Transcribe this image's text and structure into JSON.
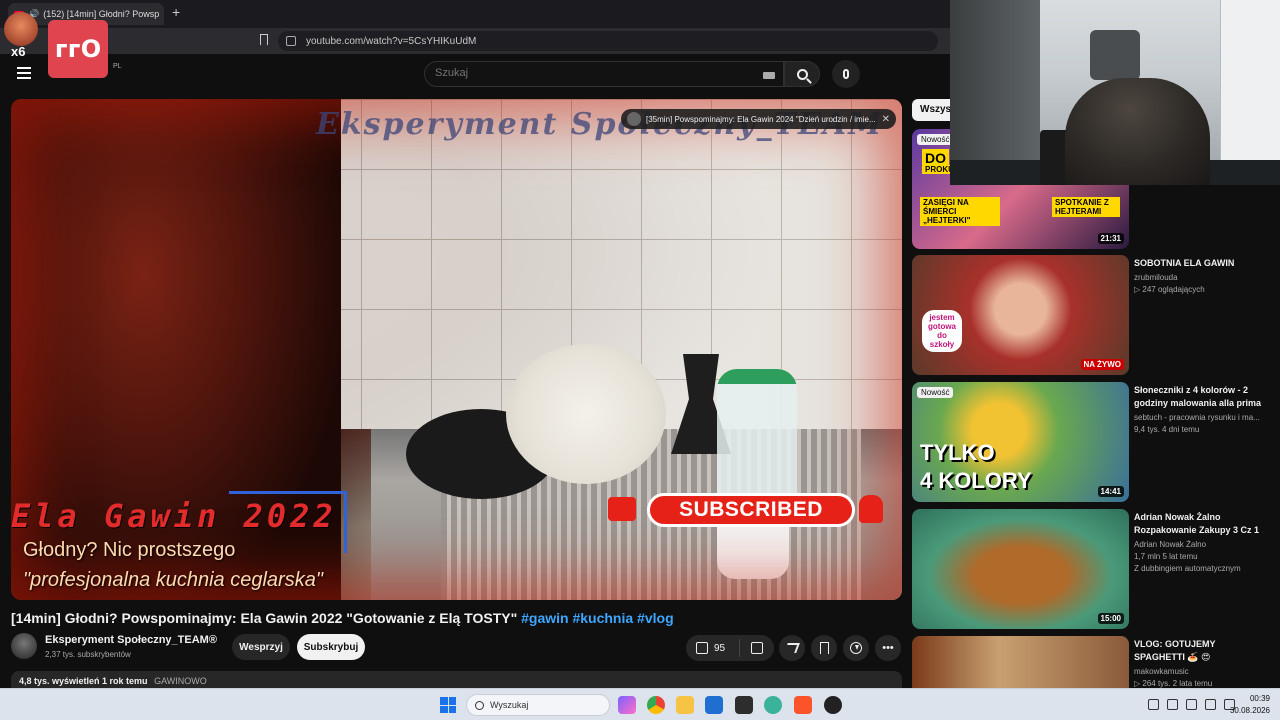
{
  "browser": {
    "tab_title": "(152) [14min] Głodni? Powsp",
    "url": "youtube.com/watch?v=5CsYHIKuUdM"
  },
  "masthead": {
    "logo": "e",
    "region": "PL",
    "search_placeholder": "Szukaj"
  },
  "overlay_badge": {
    "multiplier": "x6",
    "badge_text": "ᴦᴦO"
  },
  "player": {
    "watermark": "Eksperyment Społeczny_TEAM",
    "overlay_title": "Ela Gawin 2022",
    "overlay_sub1": "Głodny? Nic prostszego",
    "overlay_sub2": "\"profesjonalna kuchnia ceglarska\"",
    "subscribed_banner": "SUBSCRIBED",
    "card_text": "[35min] Powspominajmy: Ela Gawin 2024 \"Dzień urodzin / imie...",
    "card_close": "✕"
  },
  "video": {
    "title": "[14min] Głodni? Powspominajmy: Ela Gawin 2022 \"Gotowanie z Elą TOSTY\"",
    "tags": "#gawin #kuchnia #vlog",
    "channel_name": "Eksperyment Społeczny_TEAM®",
    "subscribers": "2,37 tys. subskrybentów",
    "support_label": "Wesprzyj",
    "subscribe_label": "Subskrybuj",
    "likes": "95",
    "more": "•••",
    "views": "4,8 tys. wyświetleń  1 rok temu",
    "hashtag_line": "GAWINOWO"
  },
  "sidebar": {
    "chip_label": "Wszyst",
    "items": [
      {
        "title": "",
        "channel": "",
        "stats": "",
        "duration": "21:31",
        "badge": "Nowość",
        "thumb_texts": [
          "DO",
          "PROKU",
          "ZASIĘGI NA ŚMIERCI „HEJTERKI\"",
          "SPOTKANIE Z HEJTERAMI"
        ]
      },
      {
        "title": "SOBOTNIA ELA GAWIN",
        "channel": "zrubmilouda",
        "stats": "▷ 247 oglądających",
        "live": "NA ŻYWO",
        "thumb_texts": [
          "jestem gotowa do szkoły"
        ]
      },
      {
        "title": "Słoneczniki z 4 kolorów - 2 godziny malowania alla prima",
        "channel": "sebtuch - pracownia rysunku i ma...",
        "stats": "9,4 tys.   4 dni temu",
        "duration": "14:41",
        "badge": "Nowość",
        "thumb_texts": [
          "TYLKO",
          "4 KOLORY"
        ]
      },
      {
        "title": "Adrian Nowak Żalno Rozpakowanie Zakupy 3 Cz 1",
        "channel": "Adrian Nowak Żalno",
        "stats": "1,7 mln   5 lat temu",
        "extra": "Z dubbingiem automatycznym",
        "duration": "15:00"
      },
      {
        "title": "VLOG: GOTUJEMY SPAGHETTI 🍝 😍",
        "channel": "makowkamusic",
        "stats": "▷ 264 tys.   2 lata temu"
      }
    ]
  },
  "taskbar": {
    "search_label": "Wyszukaj",
    "time": "00:39",
    "date": "30.08.2026"
  },
  "colors": {
    "youtube_red": "#ff0033",
    "link_blue": "#3ea6ff",
    "badge_red": "#e0454f"
  }
}
